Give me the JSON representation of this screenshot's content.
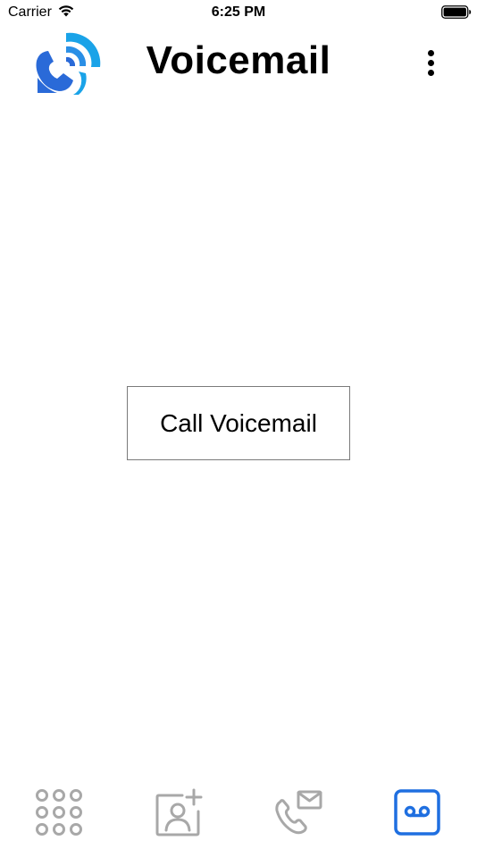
{
  "status_bar": {
    "carrier": "Carrier",
    "time": "6:25 PM"
  },
  "header": {
    "title": "Voicemail",
    "logo_icon": "phone-signal-logo-icon",
    "menu_icon": "more-vertical-icon"
  },
  "main": {
    "call_button_label": "Call Voicemail"
  },
  "tab_bar": {
    "tabs": [
      {
        "icon": "keypad-icon",
        "selected": false
      },
      {
        "icon": "add-contact-icon",
        "selected": false
      },
      {
        "icon": "phone-message-icon",
        "selected": false
      },
      {
        "icon": "voicemail-icon",
        "selected": true
      }
    ]
  },
  "colors": {
    "accent": "#1f6fe0",
    "inactive_icon": "#a8a8a8",
    "logo_dark_blue": "#2a6ad8",
    "logo_light_blue": "#1aa3e8"
  }
}
